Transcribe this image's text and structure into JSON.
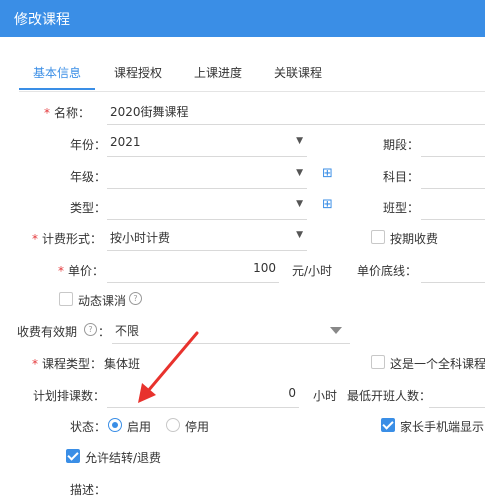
{
  "header": {
    "title": "修改课程"
  },
  "tabs": [
    "基本信息",
    "课程授权",
    "上课进度",
    "关联课程"
  ],
  "form": {
    "name": {
      "label": "名称：",
      "value": "2020街舞课程"
    },
    "year": {
      "label": "年份：",
      "value": "2021"
    },
    "term_label": "期段：",
    "grade_label": "年级：",
    "subject_label": "科目：",
    "type_label": "类型：",
    "class_type_label": "班型：",
    "billing": {
      "label": "计费形式：",
      "value": "按小时计费"
    },
    "by_term_label": "按期收费",
    "price": {
      "label": "单价：",
      "value": "100",
      "unit": "元/小时"
    },
    "floor_label": "单价底线：",
    "dynamic_cancel_label": "动态课消",
    "validity": {
      "label": "收费有效期",
      "value": "不限"
    },
    "course_type": {
      "label": "课程类型：",
      "value": "集体班"
    },
    "all_subject_label": "这是一个全科课程",
    "planned_hours": {
      "label": "计划排课数：",
      "value": "0",
      "unit": "小时"
    },
    "min_size_label": "最低开班人数：",
    "status": {
      "label": "状态：",
      "enabled": "启用",
      "disabled": "停用"
    },
    "parent_display_label": "家长手机端显示",
    "allow_transfer_label": "允许结转/退费",
    "desc_label": "描述："
  },
  "colors": {
    "accent": "#3a8ee6",
    "required": "#e4393c",
    "annotation_arrow": "#e8322d"
  }
}
